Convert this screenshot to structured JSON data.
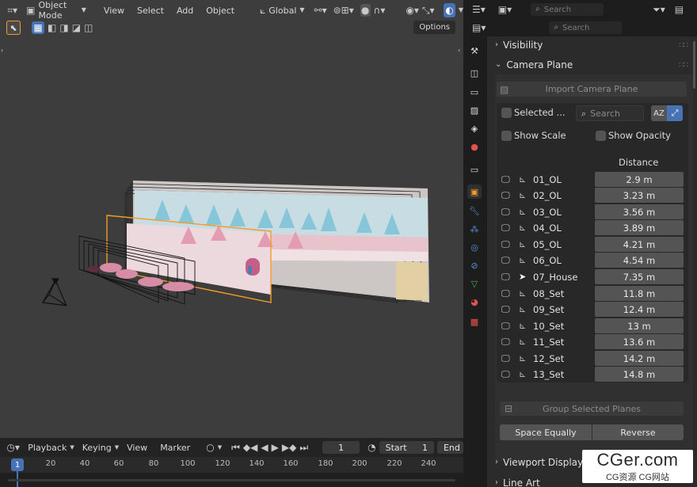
{
  "viewport_header": {
    "mode": "Object Mode",
    "menus": [
      "View",
      "Select",
      "Add",
      "Object"
    ],
    "orientation": "Global",
    "options": "Options"
  },
  "timeline": {
    "menus": [
      "Playback",
      "Keying",
      "View",
      "Marker"
    ],
    "current_frame": "1",
    "start_label": "Start",
    "start_value": "1",
    "end_label": "End",
    "ruler": [
      "1",
      "20",
      "40",
      "60",
      "80",
      "100",
      "120",
      "140",
      "160",
      "180",
      "200",
      "220",
      "240"
    ]
  },
  "outliner": {
    "search_placeholder": "Search"
  },
  "properties": {
    "search_placeholder": "Search",
    "visibility_label": "Visibility",
    "camera_plane_label": "Camera Plane",
    "import_label": "Import Camera Plane",
    "selected_label": "Selected ...",
    "filter_placeholder": "Search",
    "sort_label": "AZ",
    "show_scale": "Show Scale",
    "show_opacity": "Show Opacity",
    "distance_header": "Distance",
    "items": [
      {
        "name": "01_OL",
        "distance": "2.9 m"
      },
      {
        "name": "02_OL",
        "distance": "3.23 m"
      },
      {
        "name": "03_OL",
        "distance": "3.56 m"
      },
      {
        "name": "04_OL",
        "distance": "3.89 m"
      },
      {
        "name": "05_OL",
        "distance": "4.21 m"
      },
      {
        "name": "06_OL",
        "distance": "4.54 m"
      },
      {
        "name": "07_House",
        "distance": "7.35 m"
      },
      {
        "name": "08_Set",
        "distance": "11.8 m"
      },
      {
        "name": "09_Set",
        "distance": "12.4 m"
      },
      {
        "name": "10_Set",
        "distance": "13 m"
      },
      {
        "name": "11_Set",
        "distance": "13.6 m"
      },
      {
        "name": "12_Set",
        "distance": "14.2 m"
      },
      {
        "name": "13_Set",
        "distance": "14.8 m"
      }
    ],
    "group_label": "Group Selected Planes",
    "space_label": "Space Equally",
    "reverse_label": "Reverse",
    "viewport_display_label": "Viewport Display",
    "line_art_label": "Line Art"
  },
  "watermark": {
    "top": "CGer.com",
    "bottom": "CG资源 CG网站"
  },
  "colors": {
    "accent": "#4772b3",
    "selection": "#f29c2b",
    "panel": "#2b2b2b"
  }
}
